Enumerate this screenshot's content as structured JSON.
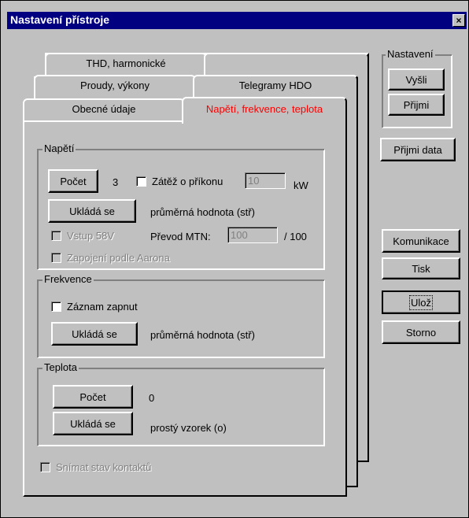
{
  "window": {
    "title": "Nastavení přístroje",
    "close_label": "×"
  },
  "tabs": {
    "thd": "THD, harmonické",
    "blank": "",
    "proudy": "Proudy, výkony",
    "telegramy": "Telegramy HDO",
    "obecne": "Obecné údaje",
    "napeti": "Napětí, frekvence, teplota",
    "active_color": "#ff0000"
  },
  "napeti": {
    "title": "Napětí",
    "pocet_button": "Počet",
    "pocet_value": "3",
    "zatez_label": "Zátěž o příkonu",
    "zatez_value": "10",
    "zatez_unit": "kW",
    "uklada_button": "Ukládá se",
    "uklada_value": "průměrná hodnota (stř)",
    "vstup_label": "Vstup 58V",
    "prevod_label": "Převod MTN:",
    "prevod_value": "100",
    "prevod_suffix": "/ 100",
    "zapojeni_label": "Zapojení podle Aarona"
  },
  "frekvence": {
    "title": "Frekvence",
    "zaznam_label": "Záznam zapnut",
    "uklada_button": "Ukládá se",
    "uklada_value": "průměrná hodnota (stř)"
  },
  "teplota": {
    "title": "Teplota",
    "pocet_button": "Počet",
    "pocet_value": "0",
    "uklada_button": "Ukládá se",
    "uklada_value": "prostý vzorek (o)"
  },
  "snimat_label": "Snímat stav kontaktů",
  "nastaveni": {
    "title": "Nastavení",
    "vysli": "Vyšli",
    "prijmi": "Přijmi"
  },
  "side_buttons": {
    "prijmi_data": "Přijmi data",
    "komunikace": "Komunikace",
    "tisk": "Tisk",
    "uloz": "Ulož",
    "storno": "Storno"
  }
}
